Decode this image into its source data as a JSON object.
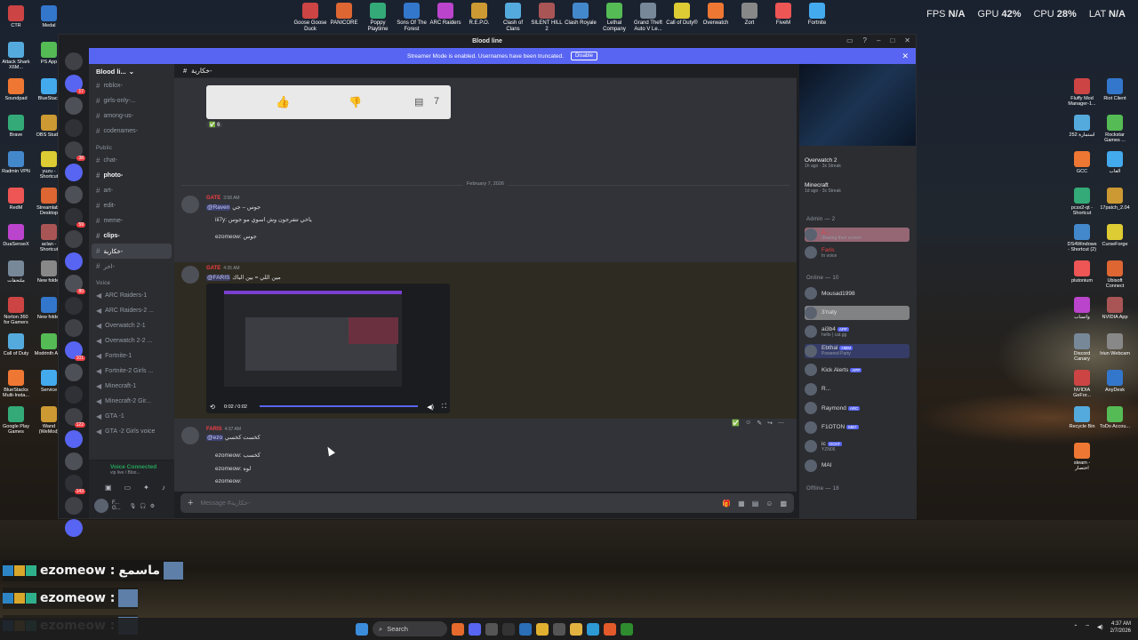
{
  "stats": {
    "fps_label": "FPS",
    "fps": "N/A",
    "gpu_label": "GPU",
    "gpu": "42",
    "cpu_label": "CPU",
    "cpu": "28",
    "lat_label": "LAT",
    "lat": "N/A",
    "pct": "%"
  },
  "top_apps": [
    "Goose Goose Duck",
    "PANICORE",
    "Poppy Playtime",
    "Sons Of The Forest",
    "ARC Raiders",
    "R.E.P.O.",
    "Clash of Clans",
    "SILENT HILL 2",
    "Clash Royale",
    "Lethal Company",
    "Grand Theft Auto V Le...",
    "Call of Duty®",
    "Overwatch",
    "Zort",
    "FiveM",
    "Fortnite"
  ],
  "desktop_left": [
    "CTR",
    "Medal",
    "Attack Shark X6M...",
    "PS App",
    "Soundpad",
    "BlueStack",
    "Brave",
    "OBS Studio",
    "Radmin VPN",
    "yuzu - Shortcut",
    "RedM",
    "Streamlabs Desktop",
    "DuaSenseX",
    "aclan - Shortcut",
    "ملتحقات",
    "New folder",
    "Norton 360 for Gamers",
    "New folder",
    "Call of Duty",
    "Modrinth App",
    "BlueStacks Multi-Insta...",
    "Service",
    "Google Play Games",
    "Wand (WeMod)"
  ],
  "desktop_right": [
    "Fluffy Mod Manager-1...",
    "Riot Client",
    "استمارة 252",
    "Rockstar Games ...",
    "GCC",
    "العاب",
    "pcsx2-qt - Shortcut",
    "17patch_2.04",
    "DS4Windows - Shortcut (2)",
    "CurseForge",
    "plutonium",
    "Ubisoft Connect",
    "واتساب",
    "NVIDIA App",
    "Discord Canary",
    "Iriun Webcam",
    "NVIDIA GeFor...",
    "AnyDesk",
    "Recycle Bin",
    "ToDo Accou...",
    "steam - اختصار"
  ],
  "window": {
    "title": "Blood line",
    "banner": "Streamer Mode is enabled. Usernames have been truncated.",
    "banner_btn": "Disable"
  },
  "server": {
    "name": "Blood li...",
    "public_label": "Public",
    "voice_label": "Voice"
  },
  "channels_top": [
    {
      "name": "roblox-",
      "unread": false
    },
    {
      "name": "girls-only-...",
      "unread": false
    },
    {
      "name": "among-us-",
      "unread": false
    },
    {
      "name": "codenames-",
      "unread": false
    }
  ],
  "channels_public": [
    {
      "name": "chat-",
      "unread": false
    },
    {
      "name": "photo-",
      "unread": true
    },
    {
      "name": "art-",
      "unread": false
    },
    {
      "name": "edit-",
      "unread": false
    },
    {
      "name": "meme-",
      "unread": false
    },
    {
      "name": "clips-",
      "unread": true
    },
    {
      "name": "خكارية-",
      "unread": false,
      "active": true
    },
    {
      "name": "اخر-",
      "unread": false
    }
  ],
  "channels_voice": [
    "ARC Raiders-1",
    "ARC Raiders-2 ...",
    "Overwatch 2-1",
    "Overwatch 2-2 ...",
    "Fortnite-1",
    "Fortnite-2 Girls ...",
    "Minecraft-1",
    "Minecraft-2 Gir...",
    "GTA -1",
    "GTA -2 Girls voice"
  ],
  "voice_panel": {
    "status": "Voice Connected",
    "sub": "vip live / Bloo..."
  },
  "user_panel": {
    "name": "F...",
    "sub": "G..."
  },
  "chat": {
    "channel": "خكارية-",
    "reaction_count": "6",
    "comment_count": "7",
    "date_divider": "February 7, 2026",
    "m1_name": "GATE",
    "m1_time": "3:58 AM",
    "m1_reply": "جوس – جي",
    "m1_mention": "@Raven",
    "m1_line1": "iii7y: ياخي تتفرجون وش اسوي مو جوس",
    "m1_line2": "ezomeow: جوس",
    "m2_name": "GATE",
    "m2_time": "4:35 AM",
    "m2_mention": "@FARIS",
    "m2_text": "مين اللي = بين الباك",
    "video_time": "0:02 / 0:02",
    "m3_name": "FARIS",
    "m3_time": "4:37 AM",
    "m3_mention": "@ezo",
    "m3_text": "كخست كخسي",
    "m3_lines": [
      "ezomeow: كخسب",
      "ezomeow: لوه",
      "ezomeow:",
      "ezomeow:"
    ],
    "input_placeholder": "Message #خكارية-"
  },
  "members": {
    "activities": [
      {
        "name": "Overwatch 2",
        "sub": "1h ago · 3x Streak"
      },
      {
        "name": "Minecraft",
        "sub": "1d ago · 3x Streak"
      }
    ],
    "admin_label": "Admin — 2",
    "admins": [
      {
        "name": "A...",
        "sub": "Sharing their screen"
      },
      {
        "name": "Faris",
        "sub": "In voice"
      }
    ],
    "online_label": "Online — 10",
    "online": [
      {
        "name": "Mousad1998",
        "sub": ""
      },
      {
        "name": "3'naty",
        "sub": ""
      },
      {
        "name": "ai3b4",
        "sub": "hello | cat.gg",
        "tag": "APP"
      },
      {
        "name": "Ebthal",
        "sub": "Powered Party",
        "tag": "HMM"
      },
      {
        "name": "Kick Alerts",
        "sub": "",
        "tag": "APP"
      },
      {
        "name": "R...",
        "sub": ""
      },
      {
        "name": "Raymond",
        "sub": "",
        "tag": "ARC"
      },
      {
        "name": "F1OTON",
        "sub": "",
        "tag": "MB7"
      },
      {
        "name": "ic",
        "sub": "YZN06",
        "tag": "GOAT"
      },
      {
        "name": "MAI",
        "sub": ""
      }
    ],
    "offline_label": "Offline — 18"
  },
  "overlay": [
    {
      "name": "ezomeow :",
      "extra": "ماسمع"
    },
    {
      "name": "ezomeow :",
      "extra": ""
    },
    {
      "name": "ezomeow :",
      "extra": ""
    }
  ],
  "overlay_caption": "ماسمع",
  "taskbar": {
    "search": "Search",
    "time": "4:37 AM",
    "date": "2/7/2026"
  }
}
